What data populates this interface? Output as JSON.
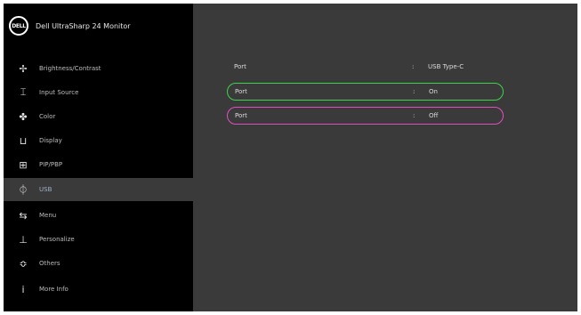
{
  "header": {
    "logo_text": "DELL",
    "model": "Dell UltraSharp 24 Monitor"
  },
  "menu": [
    {
      "icon": "brightness-contrast-icon",
      "glyph": "✢",
      "label": "Brightness/Contrast"
    },
    {
      "icon": "input-source-icon",
      "glyph": "⌶",
      "label": "Input Source"
    },
    {
      "icon": "color-icon",
      "glyph": "✤",
      "label": "Color"
    },
    {
      "icon": "display-icon",
      "glyph": "⊔",
      "label": "Display"
    },
    {
      "icon": "pip-pbp-icon",
      "glyph": "⊞",
      "label": "PIP/PBP"
    },
    {
      "icon": "usb-icon",
      "glyph": "⏀",
      "label": "USB"
    },
    {
      "icon": "menu-settings-icon",
      "glyph": "⇆",
      "label": "Menu"
    },
    {
      "icon": "personalize-icon",
      "glyph": "⊥",
      "label": "Personalize"
    },
    {
      "icon": "others-icon",
      "glyph": "≎",
      "label": "Others"
    },
    {
      "icon": "more-info-icon",
      "glyph": "ⅰ",
      "label": "More Info"
    }
  ],
  "active_index": 5,
  "rows": [
    {
      "key": "Port",
      "value": "USB Type-C"
    },
    {
      "key": "Port",
      "value": "On"
    },
    {
      "key": "Port",
      "value": "Off"
    }
  ],
  "colors": {
    "sidebar_bg": "#000000",
    "main_bg": "#3a3a3a",
    "highlight_green": "#3bd44a",
    "highlight_magenta": "#e04fc0"
  }
}
